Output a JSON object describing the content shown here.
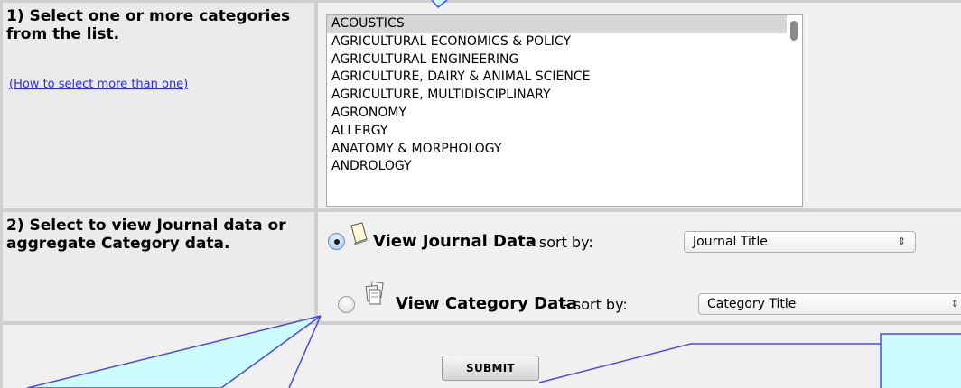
{
  "step1": {
    "title": "1) Select one or more categories from the list.",
    "help_link": "(How to select more than one)"
  },
  "categories": {
    "selected": "ACOUSTICS",
    "items": [
      "ACOUSTICS",
      "AGRICULTURAL ECONOMICS & POLICY",
      "AGRICULTURAL ENGINEERING",
      "AGRICULTURE, DAIRY & ANIMAL SCIENCE",
      "AGRICULTURE, MULTIDISCIPLINARY",
      "AGRONOMY",
      "ALLERGY",
      "ANATOMY & MORPHOLOGY",
      "ANDROLOGY"
    ]
  },
  "step2": {
    "title": "2) Select to view Journal data or aggregate Category data.",
    "journal": {
      "label": "View Journal Data",
      "sort_text": " - sort by:",
      "sort_value": "Journal Title",
      "checked": true,
      "icon": "journal-page-icon"
    },
    "category": {
      "label": "View Category Data",
      "sort_text": " - sort by:",
      "sort_value": "Category Title",
      "checked": false,
      "icon": "category-stack-icon"
    }
  },
  "submit_label": "SUBMIT",
  "colors": {
    "callout_fill": "#ccfcff",
    "callout_stroke": "#4a4ad8",
    "link": "#2a2ae0",
    "selected_row": "#d6d6d6"
  }
}
